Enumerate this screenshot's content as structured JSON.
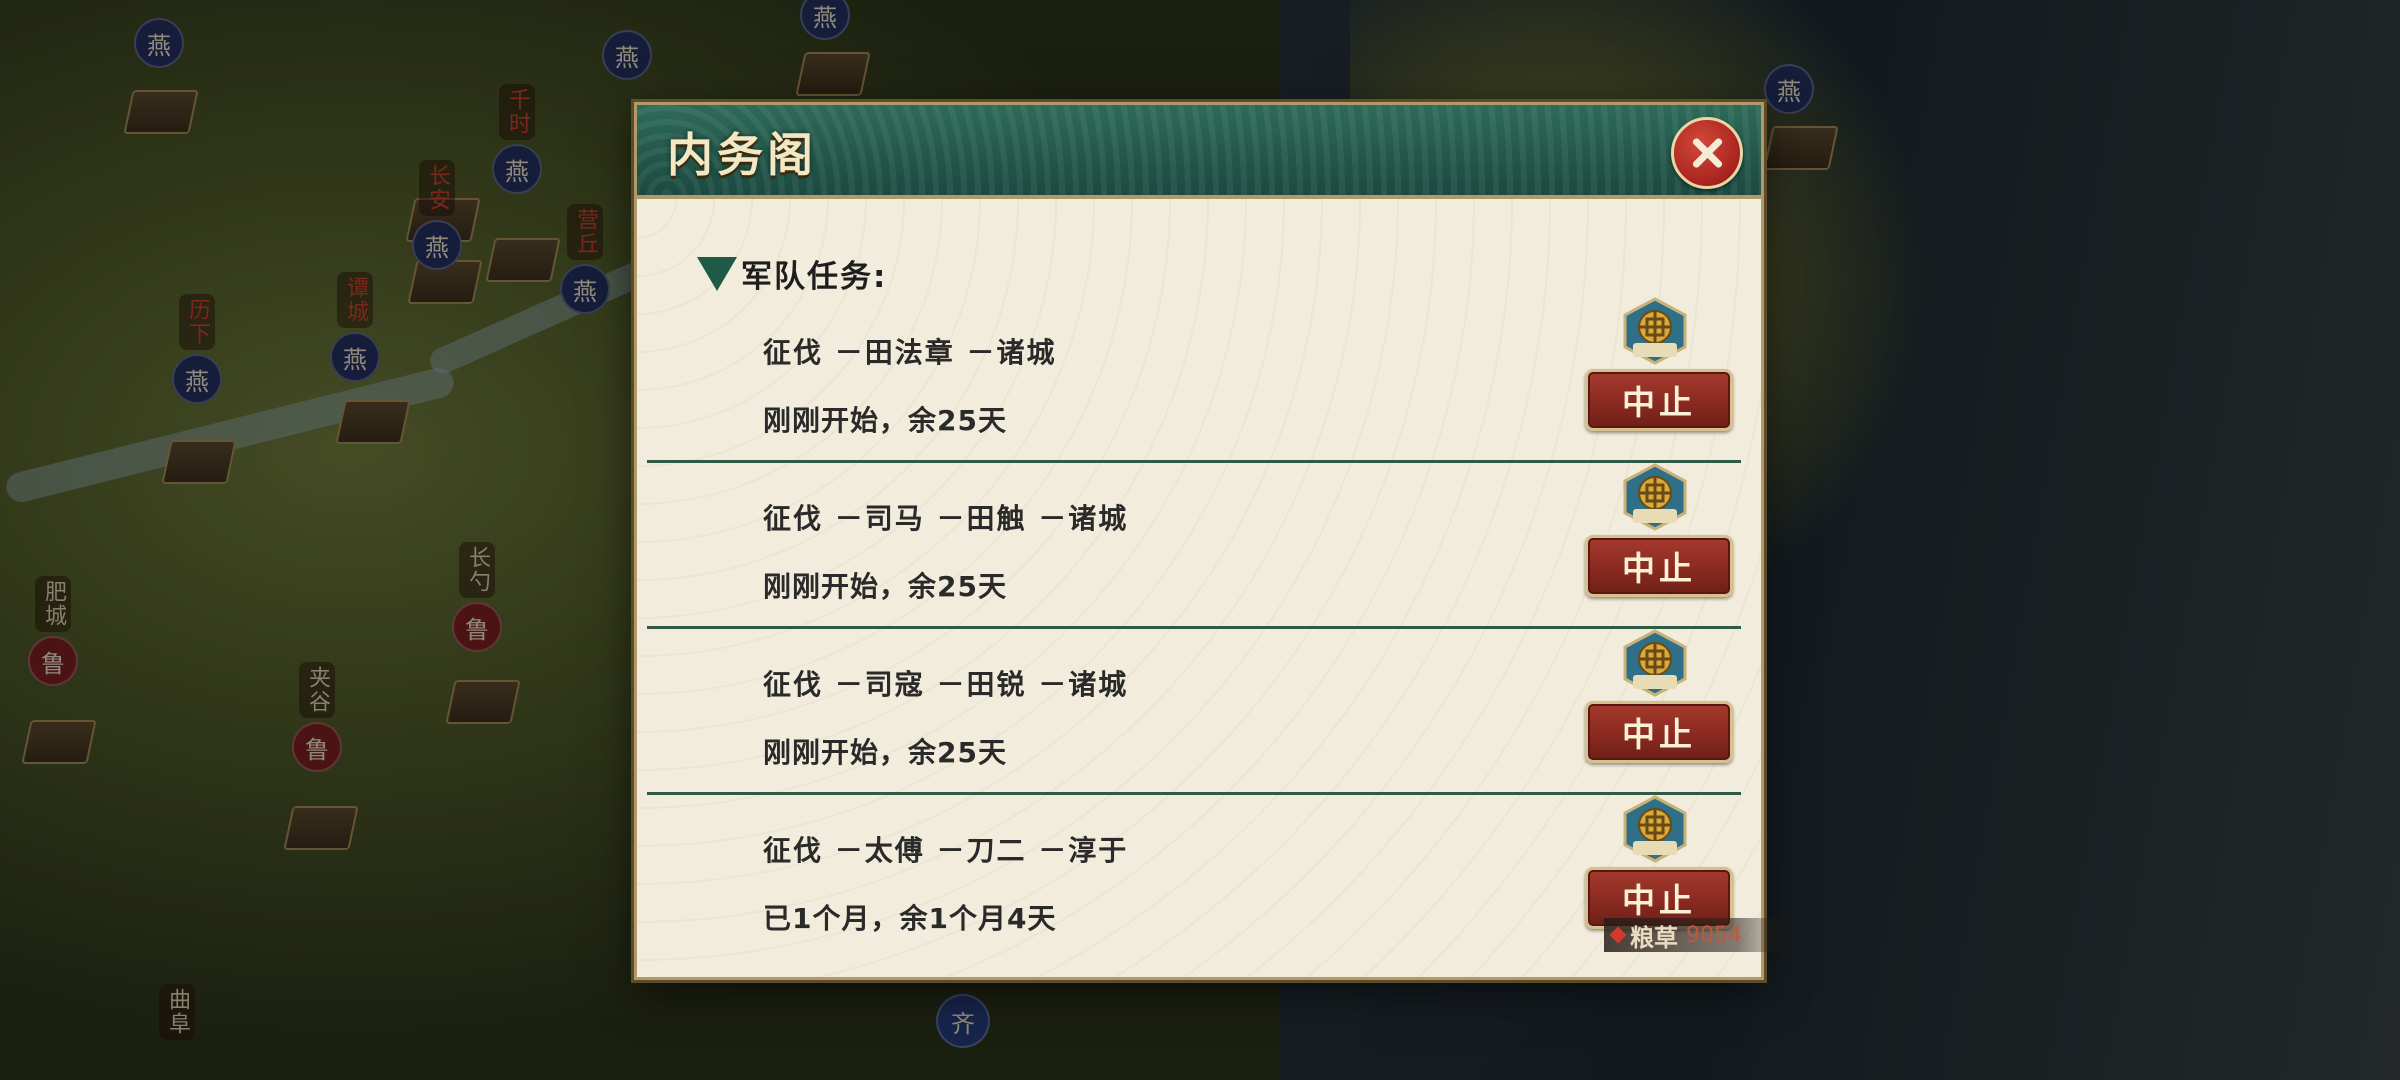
{
  "dialog": {
    "title": "内务阁",
    "section_title": "军队任务:"
  },
  "tasks": [
    {
      "title": "征伐 －田法章 －诸城",
      "status": "刚刚开始，余25天",
      "stop_label": "中止",
      "icon": "campaign-seal-icon"
    },
    {
      "title": "征伐 －司马 －田触 －诸城",
      "status": "刚刚开始，余25天",
      "stop_label": "中止",
      "icon": "campaign-seal-icon"
    },
    {
      "title": "征伐 －司寇 －田锐 －诸城",
      "status": "刚刚开始，余25天",
      "stop_label": "中止",
      "icon": "campaign-seal-icon"
    },
    {
      "title": "征伐 －太傅 －刀二 －淳于",
      "status": "已1个月，余1个月4天",
      "stop_label": "中止",
      "icon": "campaign-seal-icon"
    }
  ],
  "resource": {
    "label": "粮草",
    "value": "9054"
  },
  "map": {
    "cities": [
      {
        "name": "千时",
        "faction": "燕"
      },
      {
        "name": "长安",
        "faction": "燕"
      },
      {
        "name": "营丘",
        "faction": "燕"
      },
      {
        "name": "谭城",
        "faction": "燕"
      },
      {
        "name": "历下",
        "faction": "燕"
      },
      {
        "name": "肥城",
        "faction": "鲁"
      },
      {
        "name": "长勺",
        "faction": "鲁"
      },
      {
        "name": "夹谷",
        "faction": "鲁"
      },
      {
        "name": "曲阜",
        "faction": "鲁"
      }
    ],
    "factions": {
      "yan": "燕",
      "lu": "鲁",
      "qi": "齐"
    },
    "colors": {
      "yan_seal": "#24305e",
      "lu_seal": "#7a2020",
      "qi_seal": "#263a7a"
    }
  }
}
